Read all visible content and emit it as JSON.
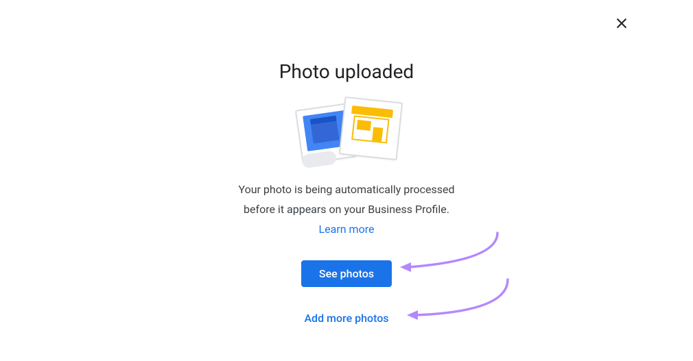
{
  "dialog": {
    "title": "Photo uploaded",
    "description_line1": "Your photo is being automatically processed",
    "description_line2": "before it appears on your Business Profile.",
    "learn_more_label": "Learn more",
    "primary_button_label": "See photos",
    "secondary_link_label": "Add more photos"
  }
}
